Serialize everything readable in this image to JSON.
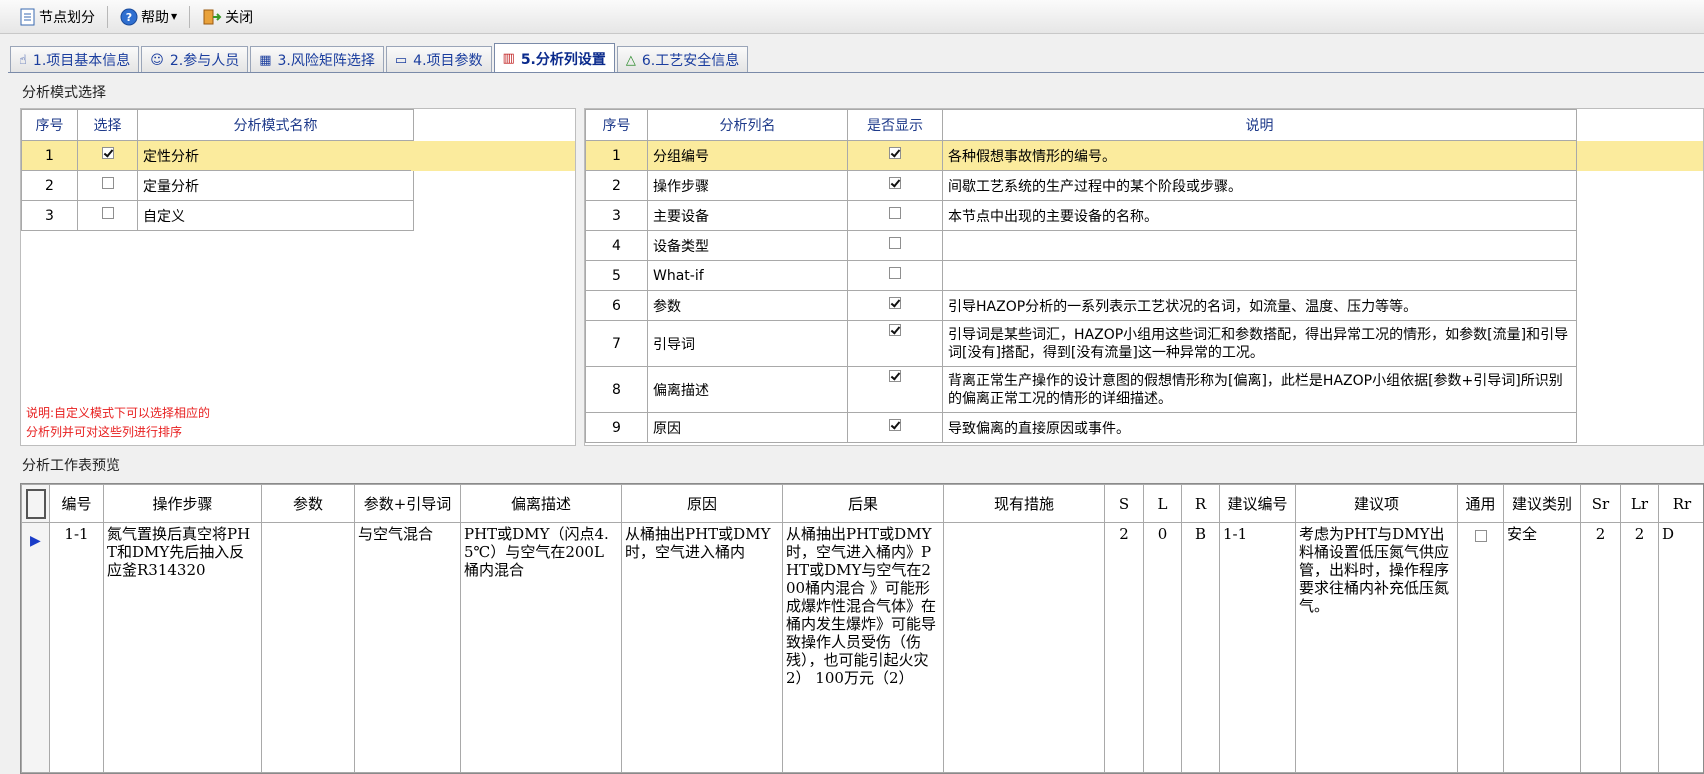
{
  "toolbar": {
    "node_label": "节点划分",
    "help_label": "帮助",
    "close_label": "关闭"
  },
  "tabs": [
    {
      "label": "1.项目基本信息"
    },
    {
      "label": "2.参与人员"
    },
    {
      "label": "3.风险矩阵选择"
    },
    {
      "label": "4.项目参数"
    },
    {
      "label": "5.分析列设置"
    },
    {
      "label": "6.工艺安全信息"
    }
  ],
  "mode_section": {
    "title": "分析模式选择",
    "headers": {
      "no": "序号",
      "select": "选择",
      "name": "分析模式名称"
    },
    "rows": [
      {
        "no": "1",
        "checked": true,
        "name": "定性分析"
      },
      {
        "no": "2",
        "checked": false,
        "name": "定量分析"
      },
      {
        "no": "3",
        "checked": false,
        "name": "自定义"
      }
    ],
    "note_line1": "说明:自定义模式下可以选择相应的",
    "note_line2": "分析列并可对这些列进行排序"
  },
  "columns_table": {
    "headers": {
      "no": "序号",
      "name": "分析列名",
      "show": "是否显示",
      "desc": "说明"
    },
    "rows": [
      {
        "no": "1",
        "name": "分组编号",
        "show": true,
        "desc": "各种假想事故情形的编号。"
      },
      {
        "no": "2",
        "name": "操作步骤",
        "show": true,
        "desc": "间歇工艺系统的生产过程中的某个阶段或步骤。"
      },
      {
        "no": "3",
        "name": "主要设备",
        "show": false,
        "desc": "本节点中出现的主要设备的名称。"
      },
      {
        "no": "4",
        "name": "设备类型",
        "show": false,
        "desc": ""
      },
      {
        "no": "5",
        "name": "What-if",
        "show": false,
        "desc": ""
      },
      {
        "no": "6",
        "name": "参数",
        "show": true,
        "desc": "引导HAZOP分析的一系列表示工艺状况的名词，如流量、温度、压力等等。"
      },
      {
        "no": "7",
        "name": "引导词",
        "show": true,
        "desc": "引导词是某些词汇，HAZOP小组用这些词汇和参数搭配，得出异常工况的情形，如参数[流量]和引导词[没有]搭配，得到[没有流量]这一种异常的工况。"
      },
      {
        "no": "8",
        "name": "偏离描述",
        "show": true,
        "desc": "背离正常生产操作的设计意图的假想情形称为[偏离]，此栏是HAZOP小组依据[参数+引导词]所识别的偏离正常工况的情形的详细描述。"
      },
      {
        "no": "9",
        "name": "原因",
        "show": true,
        "desc": "导致偏离的直接原因或事件。"
      }
    ]
  },
  "worksheet": {
    "title": "分析工作表预览",
    "headers": [
      "编号",
      "操作步骤",
      "参数",
      "参数+引导词",
      "偏离描述",
      "原因",
      "后果",
      "现有措施",
      "S",
      "L",
      "R",
      "建议编号",
      "建议项",
      "通用",
      "建议类别",
      "Sr",
      "Lr",
      "Rr"
    ],
    "row": {
      "id": "1-1",
      "step": "氮气置换后真空将PHT和DMY先后抽入反应釜R314320",
      "param": "",
      "param_guide": "与空气混合",
      "deviation": "PHT或DMY（闪点4.5℃）与空气在200L桶内混合",
      "cause": "从桶抽出PHT或DMY时，空气进入桶内",
      "consequence": "从桶抽出PHT或DMY时，空气进入桶内》PHT或DMY与空气在200桶内混合 》可能形成爆炸性混合气体》在桶内发生爆炸》可能导致操作人员受伤（伤残），也可能引起火灾 2） 100万元（2）",
      "measures": "",
      "s": "2",
      "l": "0",
      "r": "B",
      "rec_no": "1-1",
      "recommendation": "考虑为PHT与DMY出料桶设置低压氮气供应管，出料时，操作程序要求往桶内补充低压氮气。",
      "general": false,
      "category": "安全",
      "sr": "2",
      "lr": "2",
      "rr": "D"
    }
  }
}
